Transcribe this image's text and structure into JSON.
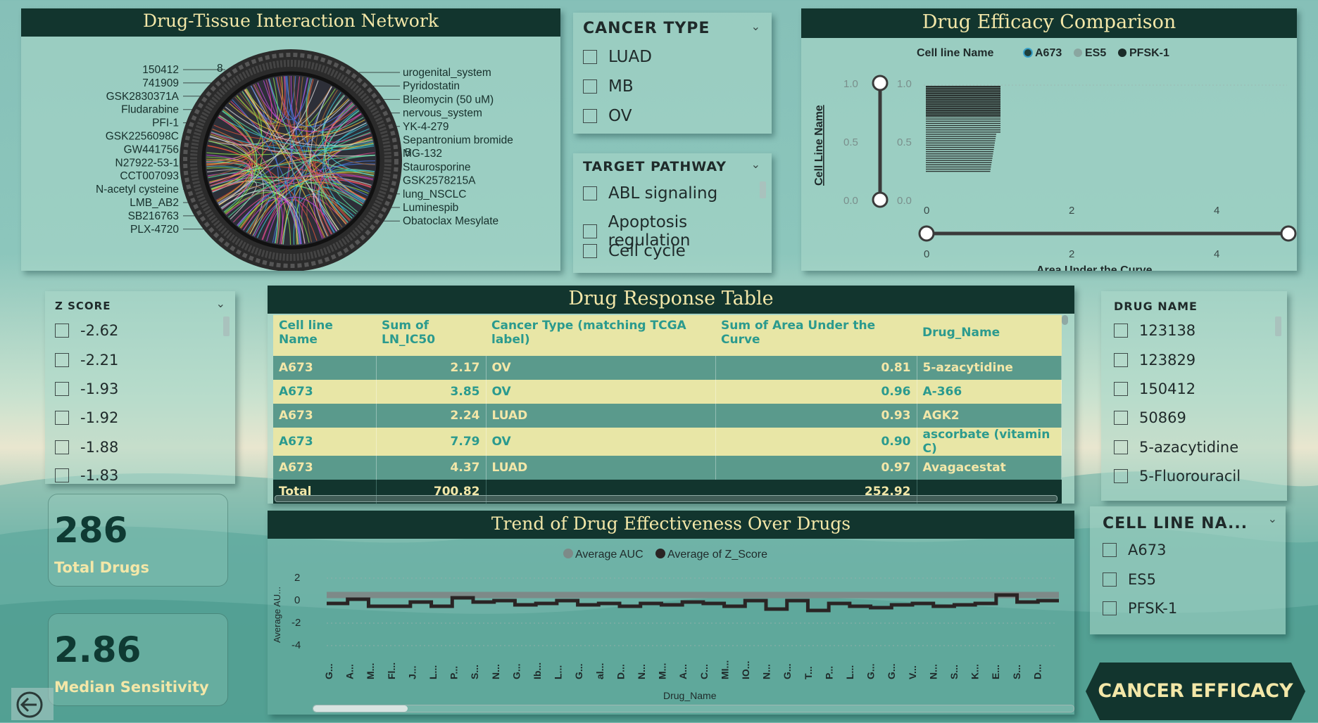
{
  "network": {
    "title": "Drug-Tissue Interaction Network",
    "left_labels": [
      "150412",
      "741909",
      "GSK2830371A",
      "Fludarabine",
      "PFI-1",
      "GSK2256098C",
      "GW441756",
      "N27922-53-1",
      "CCT007093",
      "N-acetyl cysteine",
      "LMB_AB2",
      "SB216763",
      "PLX-4720"
    ],
    "right_labels": [
      "urogenital_system",
      "Pyridostatin",
      "Bleomycin (50 uM)",
      "nervous_system",
      "YK-4-279",
      "Sepantronium bromide",
      "MG-132",
      "Staurosporine",
      "GSK2578215A",
      "lung_NSCLC",
      "Luminespib",
      "Obatoclax Mesylate"
    ],
    "tick_labels": [
      "8",
      "5"
    ]
  },
  "cancer_type": {
    "title": "CANCER TYPE",
    "options": [
      "LUAD",
      "MB",
      "OV"
    ]
  },
  "target_pathway": {
    "title": "TARGET PATHWAY",
    "options": [
      "ABL signaling",
      "Apoptosis regulation",
      "Cell cycle"
    ]
  },
  "efficacy": {
    "title": "Drug Efficacy Comparison",
    "legend_title": "Cell line Name",
    "legend": [
      {
        "name": "A673",
        "color": "#1f3f3a"
      },
      {
        "name": "ES5",
        "color": "#8aa6a0"
      },
      {
        "name": "PFSK-1",
        "color": "#1a2b28"
      }
    ],
    "y_axis_title": "Cell Line Name",
    "x_axis_title": "Area Under the Curve",
    "y_ticks": [
      "1.0",
      "0.5",
      "0.0"
    ],
    "x_ticks": [
      "0",
      "2",
      "4"
    ]
  },
  "zscore": {
    "title": "Z SCORE",
    "options": [
      "-2.62",
      "-2.21",
      "-1.93",
      "-1.92",
      "-1.88",
      "-1.83"
    ]
  },
  "table": {
    "title": "Drug Response Table",
    "headers": [
      "Cell line Name",
      "Sum of LN_IC50",
      "Cancer Type (matching TCGA label)",
      "Sum of Area Under the Curve",
      "Drug_Name"
    ],
    "rows": [
      [
        "A673",
        "2.17",
        "OV",
        "0.81",
        "5-azacytidine"
      ],
      [
        "A673",
        "3.85",
        "OV",
        "0.96",
        "A-366"
      ],
      [
        "A673",
        "2.24",
        "LUAD",
        "0.93",
        "AGK2"
      ],
      [
        "A673",
        "7.79",
        "OV",
        "0.90",
        "ascorbate (vitamin C)"
      ],
      [
        "A673",
        "4.37",
        "LUAD",
        "0.97",
        "Avagacestat"
      ]
    ],
    "total": [
      "Total",
      "700.82",
      "",
      "252.92",
      ""
    ]
  },
  "drug_name": {
    "title": "DRUG NAME",
    "options": [
      "123138",
      "123829",
      "150412",
      "50869",
      "5-azacytidine",
      "5-Fluorouracil"
    ]
  },
  "trend": {
    "title": "Trend of Drug Effectiveness Over Drugs",
    "legend": [
      {
        "name": "Average AUC",
        "color": "#7d8a88"
      },
      {
        "name": "Average of Z_Score",
        "color": "#2a2424"
      }
    ],
    "y_axis_title": "Average AU...",
    "x_axis_title": "Drug_Name",
    "y_ticks": [
      "2",
      "0",
      "-2",
      "-4"
    ],
    "x_labels": [
      "G...",
      "A...",
      "M...",
      "Fl...",
      "J...",
      "L...",
      "P...",
      "S...",
      "N...",
      "G...",
      "Ib...",
      "L...",
      "G...",
      "al...",
      "D...",
      "N...",
      "M...",
      "A...",
      "C...",
      "MI...",
      "IO...",
      "N...",
      "G...",
      "T...",
      "P...",
      "L...",
      "G...",
      "G...",
      "V...",
      "N...",
      "S...",
      "K...",
      "E...",
      "S...",
      "D..."
    ]
  },
  "cell_line": {
    "title": "CELL LINE NA...",
    "options": [
      "A673",
      "ES5",
      "PFSK-1"
    ]
  },
  "kpis": [
    {
      "value": "286",
      "label": "Total Drugs"
    },
    {
      "value": "2.86",
      "label": "Median Sensitivity"
    }
  ],
  "nav": {
    "button_label": "CANCER EFFICACY"
  },
  "colors": {
    "header_bg": "#12352e",
    "header_text": "#f3e7a8",
    "row_dark": "#5a9a8c",
    "row_light": "#e8e6a6"
  }
}
